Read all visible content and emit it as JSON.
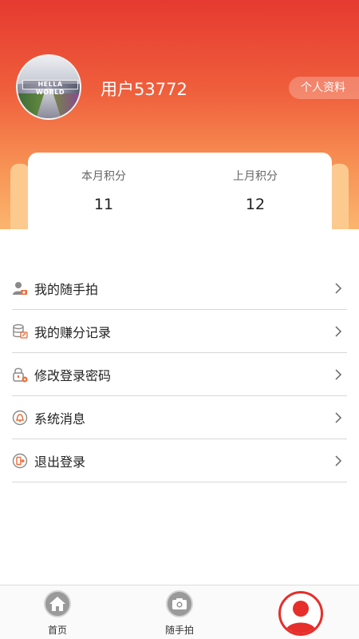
{
  "header": {
    "username": "用户53772",
    "profile_button": "个人资料",
    "avatar_logo_text": "HELLA WORLD",
    "colors": {
      "gradient_top": "#e63a30",
      "gradient_bottom": "#fbb56e"
    }
  },
  "points": {
    "this_month_label": "本月积分",
    "this_month_value": "11",
    "last_month_label": "上月积分",
    "last_month_value": "12"
  },
  "menu": {
    "items": [
      {
        "label": "我的随手拍",
        "icon": "user-camera-icon"
      },
      {
        "label": "我的赚分记录",
        "icon": "database-edit-icon"
      },
      {
        "label": "修改登录密码",
        "icon": "lock-settings-icon"
      },
      {
        "label": "系统消息",
        "icon": "bell-icon"
      },
      {
        "label": "退出登录",
        "icon": "logout-icon"
      }
    ]
  },
  "bottom_nav": {
    "tabs": [
      {
        "label": "首页",
        "icon": "home-icon"
      },
      {
        "label": "随手拍",
        "icon": "camera-icon"
      },
      {
        "label": "",
        "icon": "user-icon",
        "active": true
      }
    ],
    "active_color": "#e62e2a"
  }
}
